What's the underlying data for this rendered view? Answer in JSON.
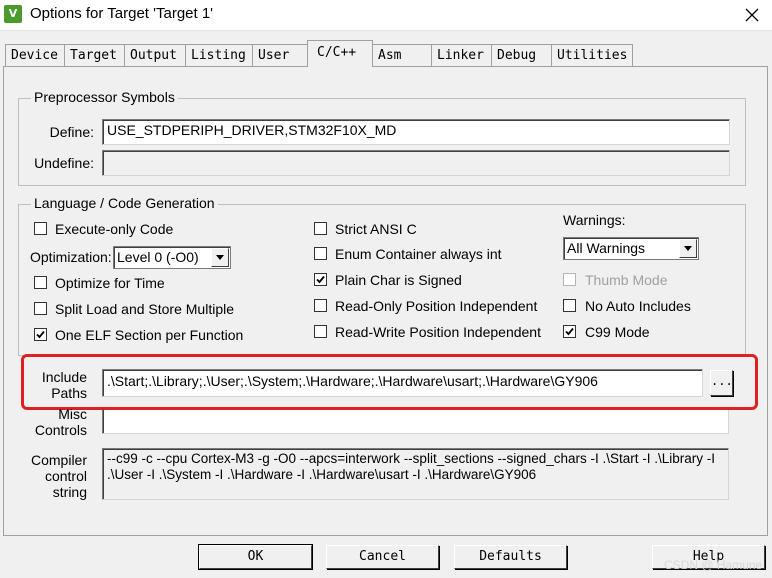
{
  "window": {
    "title": "Options for Target 'Target 1'",
    "app_icon": "keil-uvision-icon",
    "close_icon": "close-icon"
  },
  "tabs": [
    {
      "label": "Device"
    },
    {
      "label": "Target"
    },
    {
      "label": "Output"
    },
    {
      "label": "Listing"
    },
    {
      "label": "User"
    },
    {
      "label": "C/C++",
      "active": true
    },
    {
      "label": "Asm"
    },
    {
      "label": "Linker"
    },
    {
      "label": "Debug"
    },
    {
      "label": "Utilities"
    }
  ],
  "preprocessor": {
    "title": "Preprocessor Symbols",
    "define_label": "Define:",
    "define_value": "USE_STDPERIPH_DRIVER,STM32F10X_MD",
    "undefine_label": "Undefine:",
    "undefine_value": ""
  },
  "codegen": {
    "title": "Language / Code Generation",
    "execute_only": {
      "label": "Execute-only Code",
      "checked": false
    },
    "optimization_label": "Optimization:",
    "optimization_value": "Level 0 (-O0)",
    "optimize_time": {
      "label": "Optimize for Time",
      "checked": false
    },
    "split_load": {
      "label": "Split Load and Store Multiple",
      "checked": false
    },
    "one_elf": {
      "label": "One ELF Section per Function",
      "checked": true
    },
    "strict_ansi": {
      "label": "Strict ANSI C",
      "checked": false
    },
    "enum_container": {
      "label": "Enum Container always int",
      "checked": false
    },
    "plain_char": {
      "label": "Plain Char is Signed",
      "checked": true
    },
    "ropi": {
      "label": "Read-Only Position Independent",
      "checked": false
    },
    "rwpi": {
      "label": "Read-Write Position Independent",
      "checked": false
    },
    "warnings_label": "Warnings:",
    "warnings_value": "All Warnings",
    "thumb_mode": {
      "label": "Thumb Mode",
      "checked": false,
      "disabled": true
    },
    "no_auto_includes": {
      "label": "No Auto Includes",
      "checked": false
    },
    "c99_mode": {
      "label": "C99 Mode",
      "checked": true
    }
  },
  "include": {
    "label_line1": "Include",
    "label_line2": "Paths",
    "value": ".\\Start;.\\Library;.\\User;.\\System;.\\Hardware;.\\Hardware\\usart;.\\Hardware\\GY906",
    "browse_label": "..."
  },
  "misc": {
    "label_line1": "Misc",
    "label_line2": "Controls",
    "value": ""
  },
  "compiler": {
    "label_line1": "Compiler",
    "label_line2": "control",
    "label_line3": "string",
    "value": "--c99 -c --cpu Cortex-M3 -g -O0 --apcs=interwork --split_sections --signed_chars -I .\\Start -I .\\Library -I .\\User -I .\\System -I .\\Hardware -I .\\Hardware\\usart -I .\\Hardware\\GY906"
  },
  "buttons": {
    "ok": "OK",
    "cancel": "Cancel",
    "defaults": "Defaults",
    "help": "Help"
  },
  "watermark": "CSDN @ Hamune",
  "colors": {
    "highlight": "#e02020",
    "check_mark": "#000000"
  }
}
